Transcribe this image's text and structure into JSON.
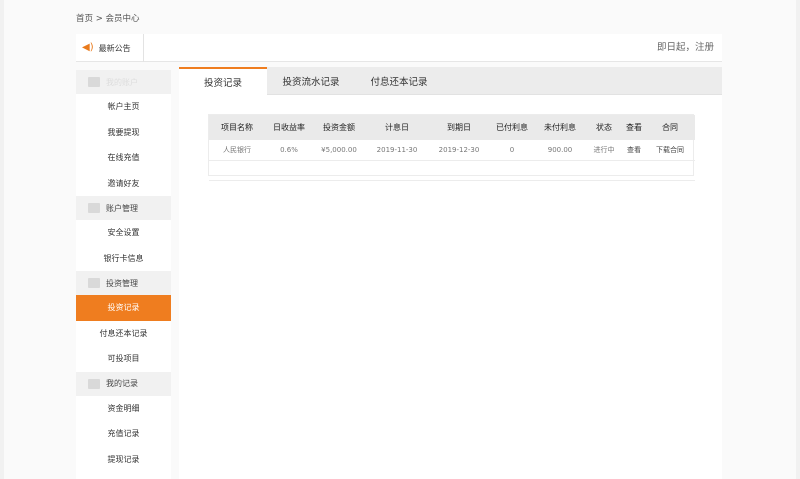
{
  "breadcrumb": "首页 > 会员中心",
  "notice": {
    "label": "最新公告",
    "scroll_text": "即日起，注册"
  },
  "sidebar": {
    "groups": [
      {
        "label": "我的账户",
        "items": [
          "帐户主页",
          "我要提现",
          "在线充值",
          "邀请好友"
        ]
      },
      {
        "label": "账户管理",
        "items": [
          "安全设置",
          "银行卡信息"
        ]
      },
      {
        "label": "投资管理",
        "items": [
          "投资记录",
          "付息还本记录",
          "可投项目"
        ]
      },
      {
        "label": "我的记录",
        "items": [
          "资金明细",
          "充值记录",
          "提现记录"
        ]
      }
    ],
    "active_item": "投资记录"
  },
  "tabs": [
    "投资记录",
    "投资流水记录",
    "付息还本记录"
  ],
  "table": {
    "headers": [
      "项目名称",
      "日收益率",
      "投资金额",
      "计息日",
      "到期日",
      "已付利息",
      "未付利息",
      "状态",
      "查看",
      "合同"
    ],
    "rows": [
      [
        "人民银行",
        "0.6%",
        "¥5,000.00",
        "2019-11-30",
        "2019-12-30",
        "0",
        "900.00",
        "进行中",
        "查看",
        "下载合同"
      ]
    ]
  },
  "colors": {
    "accent": "#ef7d1f"
  }
}
